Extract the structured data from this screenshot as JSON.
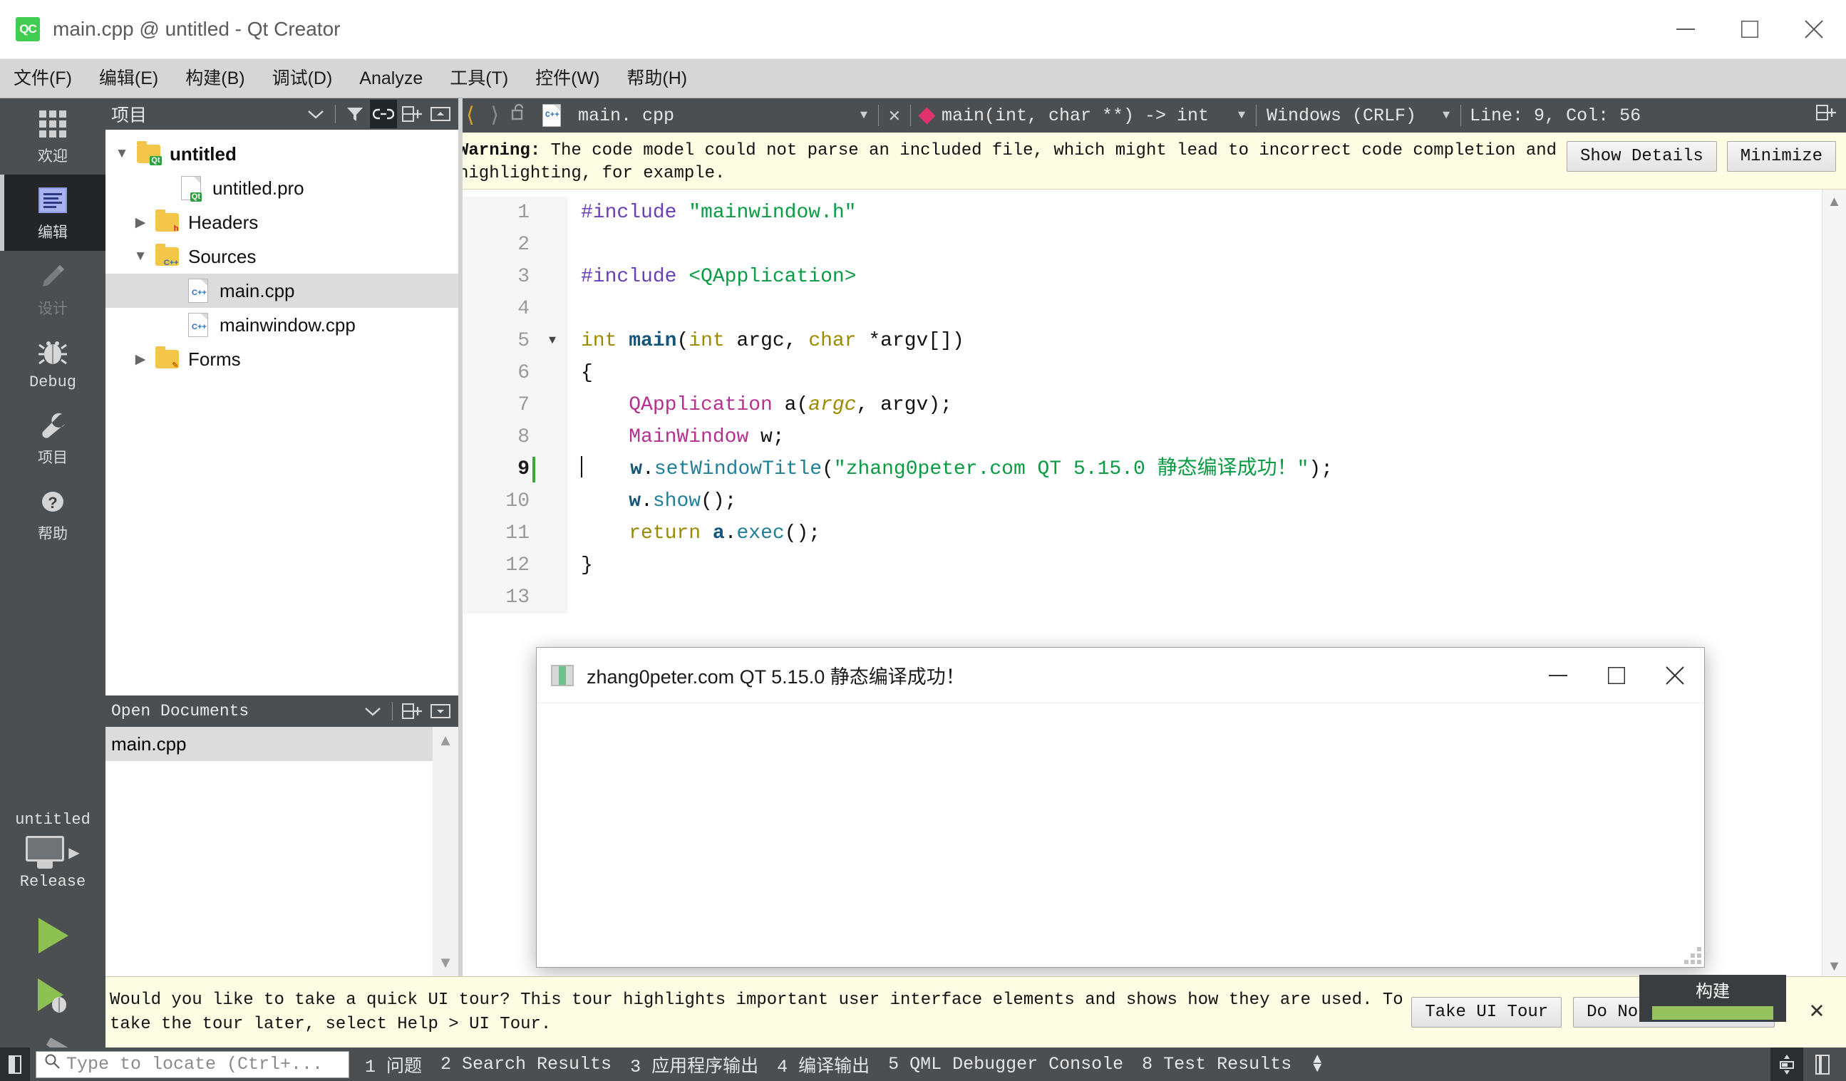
{
  "window": {
    "title": "main.cpp @ untitled - Qt Creator",
    "app_icon_text": "QC",
    "minimize": "minimize-icon",
    "maximize": "maximize-icon",
    "close": "close-icon"
  },
  "menubar": {
    "items": [
      {
        "label": "文件(F)"
      },
      {
        "label": "编辑(E)"
      },
      {
        "label": "构建(B)"
      },
      {
        "label": "调试(D)"
      },
      {
        "label": "Analyze"
      },
      {
        "label": "工具(T)"
      },
      {
        "label": "控件(W)"
      },
      {
        "label": "帮助(H)"
      }
    ]
  },
  "modebar": {
    "items": [
      {
        "label": "欢迎",
        "icon": "grid-icon",
        "state": "normal"
      },
      {
        "label": "编辑",
        "icon": "document-lines-icon",
        "state": "active"
      },
      {
        "label": "设计",
        "icon": "pencil-icon",
        "state": "disabled"
      },
      {
        "label": "Debug",
        "icon": "bug-icon",
        "state": "normal"
      },
      {
        "label": "项目",
        "icon": "wrench-icon",
        "state": "normal"
      },
      {
        "label": "帮助",
        "icon": "question-mark-icon",
        "state": "normal"
      }
    ],
    "kit": {
      "project": "untitled",
      "build_config": "Release",
      "run_label": "run-button",
      "debug_label": "run-debug-button",
      "build_label": "build-button"
    }
  },
  "project_dock": {
    "title": "项目",
    "tools": [
      "filter-icon",
      "link-icon",
      "split-add-icon",
      "close-dock-icon"
    ],
    "tree": [
      {
        "label": "untitled",
        "indent": 0,
        "twisty": "down",
        "icon": "folder-qt-icon",
        "bold": true,
        "selected": false
      },
      {
        "label": "untitled.pro",
        "indent": 1,
        "twisty": "none",
        "icon": "file-qt-icon",
        "bold": false,
        "selected": false
      },
      {
        "label": "Headers",
        "indent": 1,
        "twisty": "right",
        "icon": "folder-h-icon",
        "bold": false,
        "selected": false
      },
      {
        "label": "Sources",
        "indent": 1,
        "twisty": "down",
        "icon": "folder-cpp-icon",
        "bold": false,
        "selected": false
      },
      {
        "label": "main.cpp",
        "indent": 2,
        "twisty": "none",
        "icon": "file-cpp-icon",
        "bold": false,
        "selected": true
      },
      {
        "label": "mainwindow.cpp",
        "indent": 2,
        "twisty": "none",
        "icon": "file-cpp-icon",
        "bold": false,
        "selected": false
      },
      {
        "label": "Forms",
        "indent": 1,
        "twisty": "right",
        "icon": "folder-ui-icon",
        "bold": false,
        "selected": false
      }
    ]
  },
  "open_documents": {
    "title": "Open Documents",
    "tools": [
      "split-add-icon",
      "close-dock-icon"
    ],
    "items": [
      {
        "label": "main.cpp",
        "selected": true
      }
    ]
  },
  "editor_toolbar": {
    "back": "back-arrow-icon",
    "forward": "forward-arrow-icon",
    "lock": "unlock-icon",
    "file_name": "main. cpp",
    "close_tab": "close-icon",
    "symbol": "main(int, char **) -> int",
    "line_ending": "Windows (CRLF)",
    "cursor_position": "Line: 9, Col: 56",
    "split_button": "split-add-icon"
  },
  "warning_bar": {
    "label": "Warning:",
    "message": " The code model could not parse an included file, which might lead to incorrect code completion and highlighting, for example.",
    "show_details": "Show Details",
    "minimize": "Minimize"
  },
  "editor": {
    "line_numbers": [
      "1",
      "2",
      "3",
      "4",
      "5",
      "6",
      "7",
      "8",
      "9",
      "10",
      "11",
      "12",
      "13"
    ],
    "current_line": 9,
    "fold_marker_line": 5,
    "lines": [
      [
        {
          "t": "#include",
          "c": "pre"
        },
        {
          "t": " ",
          "c": "plain"
        },
        {
          "t": "\"mainwindow.h\"",
          "c": "str"
        }
      ],
      [],
      [
        {
          "t": "#include",
          "c": "pre"
        },
        {
          "t": " ",
          "c": "plain"
        },
        {
          "t": "<QApplication>",
          "c": "str"
        }
      ],
      [],
      [
        {
          "t": "int",
          "c": "type"
        },
        {
          "t": " ",
          "c": "plain"
        },
        {
          "t": "main",
          "c": "fn"
        },
        {
          "t": "(",
          "c": "plain"
        },
        {
          "t": "int",
          "c": "type"
        },
        {
          "t": " argc, ",
          "c": "plain"
        },
        {
          "t": "char",
          "c": "type"
        },
        {
          "t": " *argv[])",
          "c": "plain"
        }
      ],
      [
        {
          "t": "{",
          "c": "plain"
        }
      ],
      [
        {
          "t": "    ",
          "c": "plain"
        },
        {
          "t": "QApplication",
          "c": "cls"
        },
        {
          "t": " a(",
          "c": "plain"
        },
        {
          "t": "argc",
          "c": "param"
        },
        {
          "t": ", argv);",
          "c": "plain"
        }
      ],
      [
        {
          "t": "    ",
          "c": "plain"
        },
        {
          "t": "MainWindow",
          "c": "cls"
        },
        {
          "t": " w;",
          "c": "plain"
        }
      ],
      [
        {
          "t": "    ",
          "c": "plain"
        },
        {
          "t": "w",
          "c": "fn"
        },
        {
          "t": ".",
          "c": "plain"
        },
        {
          "t": "setWindowTitle",
          "c": "mem"
        },
        {
          "t": "(",
          "c": "plain"
        },
        {
          "t": "\"zhang0peter.com QT 5.15.0 静态编译成功！\"",
          "c": "str"
        },
        {
          "t": ");",
          "c": "plain"
        }
      ],
      [
        {
          "t": "    ",
          "c": "plain"
        },
        {
          "t": "w",
          "c": "fn"
        },
        {
          "t": ".",
          "c": "plain"
        },
        {
          "t": "show",
          "c": "mem"
        },
        {
          "t": "();",
          "c": "plain"
        }
      ],
      [
        {
          "t": "    ",
          "c": "plain"
        },
        {
          "t": "return",
          "c": "type"
        },
        {
          "t": " ",
          "c": "plain"
        },
        {
          "t": "a",
          "c": "fn"
        },
        {
          "t": ".",
          "c": "plain"
        },
        {
          "t": "exec",
          "c": "mem"
        },
        {
          "t": "();",
          "c": "plain"
        }
      ],
      [
        {
          "t": "}",
          "c": "plain"
        }
      ],
      []
    ]
  },
  "app_window": {
    "title": "zhang0peter.com QT 5.15.0 静态编译成功！",
    "icon": "app-window-icon",
    "minimize": "minimize-icon",
    "maximize": "maximize-icon",
    "close": "close-icon"
  },
  "tour_bar": {
    "message": "Would you like to take a quick UI tour? This tour highlights important user interface elements and shows how they are used. To take the tour later, select Help > UI Tour.",
    "take_tour": "Take UI Tour",
    "dismiss": "Do Not Show Again",
    "close": "close-icon"
  },
  "build_popup": {
    "label": "构建",
    "progress_color": "#97c35e"
  },
  "statusbar": {
    "sidebar_toggle": "sidebar-toggle-icon",
    "locator_placeholder": "Type to locate (Ctrl+...",
    "locator_icon": "search-icon",
    "panels": [
      {
        "label": "1 问题"
      },
      {
        "label": "2 Search Results"
      },
      {
        "label": "3 应用程序输出"
      },
      {
        "label": "4 编译输出"
      },
      {
        "label": "5 QML Debugger Console"
      },
      {
        "label": "8 Test Results"
      }
    ],
    "right_buttons": [
      "progress-details-icon",
      "output-pane-toggle-icon"
    ]
  },
  "colors": {
    "accent_green": "#41cd52",
    "dark_panel": "#4b4f52",
    "active_panel": "#232629",
    "warning_bg": "#fdfde4",
    "selection": "#dcdcdc",
    "cursor_line": "#3fa63f",
    "progress_green": "#97c35e"
  }
}
